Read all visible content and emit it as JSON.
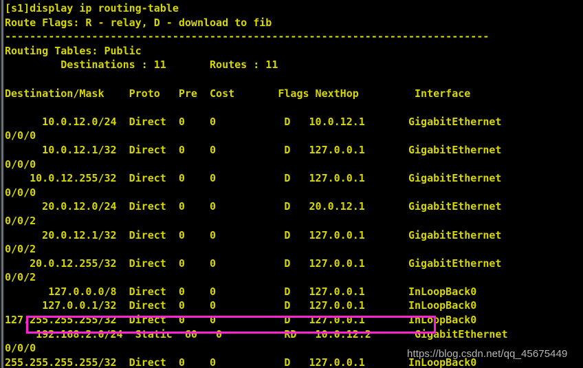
{
  "terminal": {
    "prompt_line": "[s1]display ip routing-table",
    "route_flags_line": "Route Flags: R - relay, D - download to fib",
    "separator": "------------------------------------------------------------------------------",
    "routing_tables_line": "Routing Tables: Public",
    "summary_line": "         Destinations : 11       Routes : 11",
    "blank": "",
    "header_line": "Destination/Mask    Proto   Pre  Cost       Flags NextHop         Interface",
    "columns": [
      "Destination/Mask",
      "Proto",
      "Pre",
      "Cost",
      "Flags",
      "NextHop",
      "Interface"
    ],
    "foreground_color": "#d7d700",
    "background_color": "#000000",
    "highlight_color": "#ff22d0"
  },
  "routes": [
    {
      "line": "      10.0.12.0/24  Direct  0    0           D   10.0.12.1       GigabitEthernet",
      "wrap": "0/0/0",
      "destination": "10.0.12.0/24",
      "proto": "Direct",
      "pre": "0",
      "cost": "0",
      "flags": "D",
      "nexthop": "10.0.12.1",
      "interface": "GigabitEthernet0/0/0",
      "highlighted": false
    },
    {
      "line": "      10.0.12.1/32  Direct  0    0           D   127.0.0.1       GigabitEthernet",
      "wrap": "0/0/0",
      "destination": "10.0.12.1/32",
      "proto": "Direct",
      "pre": "0",
      "cost": "0",
      "flags": "D",
      "nexthop": "127.0.0.1",
      "interface": "GigabitEthernet0/0/0",
      "highlighted": false
    },
    {
      "line": "    10.0.12.255/32  Direct  0    0           D   127.0.0.1       GigabitEthernet",
      "wrap": "0/0/0",
      "destination": "10.0.12.255/32",
      "proto": "Direct",
      "pre": "0",
      "cost": "0",
      "flags": "D",
      "nexthop": "127.0.0.1",
      "interface": "GigabitEthernet0/0/0",
      "highlighted": false
    },
    {
      "line": "      20.0.12.0/24  Direct  0    0           D   20.0.12.1       GigabitEthernet",
      "wrap": "0/0/2",
      "destination": "20.0.12.0/24",
      "proto": "Direct",
      "pre": "0",
      "cost": "0",
      "flags": "D",
      "nexthop": "20.0.12.1",
      "interface": "GigabitEthernet0/0/2",
      "highlighted": false
    },
    {
      "line": "      20.0.12.1/32  Direct  0    0           D   127.0.0.1       GigabitEthernet",
      "wrap": "0/0/2",
      "destination": "20.0.12.1/32",
      "proto": "Direct",
      "pre": "0",
      "cost": "0",
      "flags": "D",
      "nexthop": "127.0.0.1",
      "interface": "GigabitEthernet0/0/2",
      "highlighted": false
    },
    {
      "line": "    20.0.12.255/32  Direct  0    0           D   127.0.0.1       GigabitEthernet",
      "wrap": "0/0/2",
      "destination": "20.0.12.255/32",
      "proto": "Direct",
      "pre": "0",
      "cost": "0",
      "flags": "D",
      "nexthop": "127.0.0.1",
      "interface": "GigabitEthernet0/0/2",
      "highlighted": false
    },
    {
      "line": "       127.0.0.0/8  Direct  0    0           D   127.0.0.1       InLoopBack0",
      "wrap": null,
      "destination": "127.0.0.0/8",
      "proto": "Direct",
      "pre": "0",
      "cost": "0",
      "flags": "D",
      "nexthop": "127.0.0.1",
      "interface": "InLoopBack0",
      "highlighted": false
    },
    {
      "line": "      127.0.0.1/32  Direct  0    0           D   127.0.0.1       InLoopBack0",
      "wrap": null,
      "destination": "127.0.0.1/32",
      "proto": "Direct",
      "pre": "0",
      "cost": "0",
      "flags": "D",
      "nexthop": "127.0.0.1",
      "interface": "InLoopBack0",
      "highlighted": false
    },
    {
      "line": "127.255.255.255/32  Direct  0    0           D   127.0.0.1       InLoopBack0",
      "wrap": null,
      "destination": "127.255.255.255/32",
      "proto": "Direct",
      "pre": "0",
      "cost": "0",
      "flags": "D",
      "nexthop": "127.0.0.1",
      "interface": "InLoopBack0",
      "highlighted": false
    },
    {
      "line": "     192.168.2.0/24  Static  60   0          RD   10.0.12.2       GigabitEthernet",
      "wrap": "0/0/0",
      "destination": "192.168.2.0/24",
      "proto": "Static",
      "pre": "60",
      "cost": "0",
      "flags": "RD",
      "nexthop": "10.0.12.2",
      "interface": "GigabitEthernet0/0/0",
      "highlighted": true
    },
    {
      "line": "255.255.255.255/32  Direct  0    0           D   127.0.0.1       InLoopBack0",
      "wrap": null,
      "destination": "255.255.255.255/32",
      "proto": "Direct",
      "pre": "0",
      "cost": "0",
      "flags": "D",
      "nexthop": "127.0.0.1",
      "interface": "InLoopBack0",
      "highlighted": false
    }
  ],
  "watermark": {
    "text": "https://blog.csdn.net/qq_45675449"
  }
}
